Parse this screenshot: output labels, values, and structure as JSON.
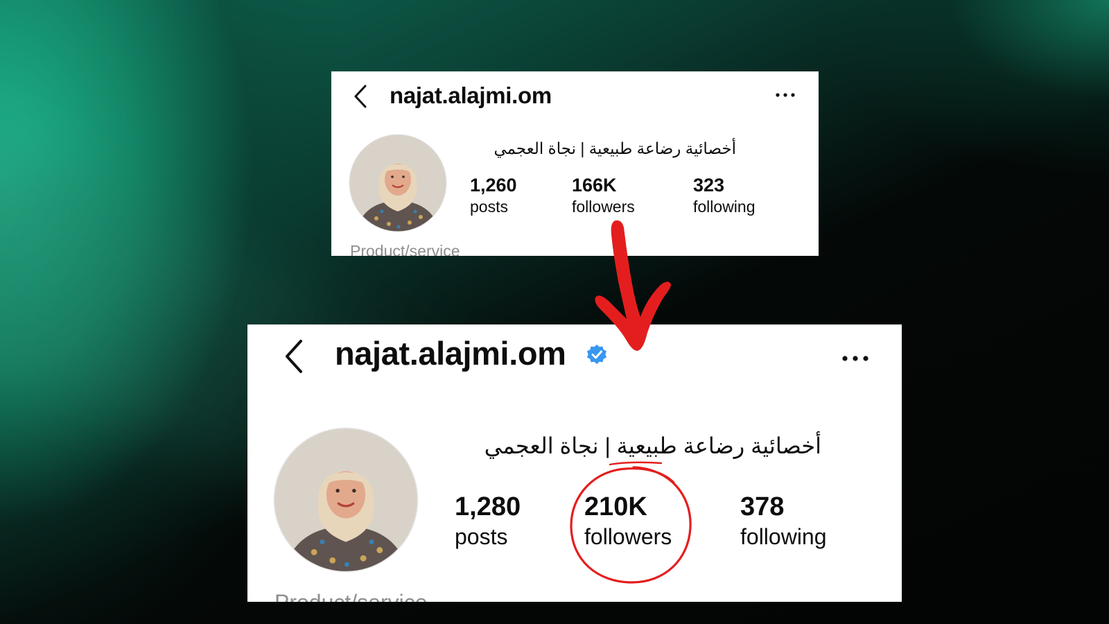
{
  "before": {
    "username": "najat.alajmi.om",
    "display_name": "أخصائية رضاعة طبيعية | نجاة العجمي",
    "stats": [
      {
        "value": "1,260",
        "label": "posts"
      },
      {
        "value": "166K",
        "label": "followers"
      },
      {
        "value": "323",
        "label": "following"
      }
    ],
    "category": "Product/service",
    "icons": {
      "back": "chevron-left-icon",
      "more": "more-horizontal-icon"
    }
  },
  "after": {
    "username": "najat.alajmi.om",
    "verified": true,
    "display_name": "أخصائية رضاعة طبيعية | نجاة العجمي",
    "stats": [
      {
        "value": "1,280",
        "label": "posts"
      },
      {
        "value": "210K",
        "label": "followers"
      },
      {
        "value": "378",
        "label": "following"
      }
    ],
    "category": "Product/service",
    "icons": {
      "back": "chevron-left-icon",
      "more": "more-horizontal-icon",
      "verified": "verified-badge-icon"
    }
  },
  "annotations": {
    "arrow_color": "#e41e1e",
    "circle_color": "#e41e1e",
    "circled_stat": "followers"
  },
  "colors": {
    "background_accent": "#1fbd92",
    "verified_blue": "#3897f0",
    "category_gray": "#8e8e8e"
  }
}
